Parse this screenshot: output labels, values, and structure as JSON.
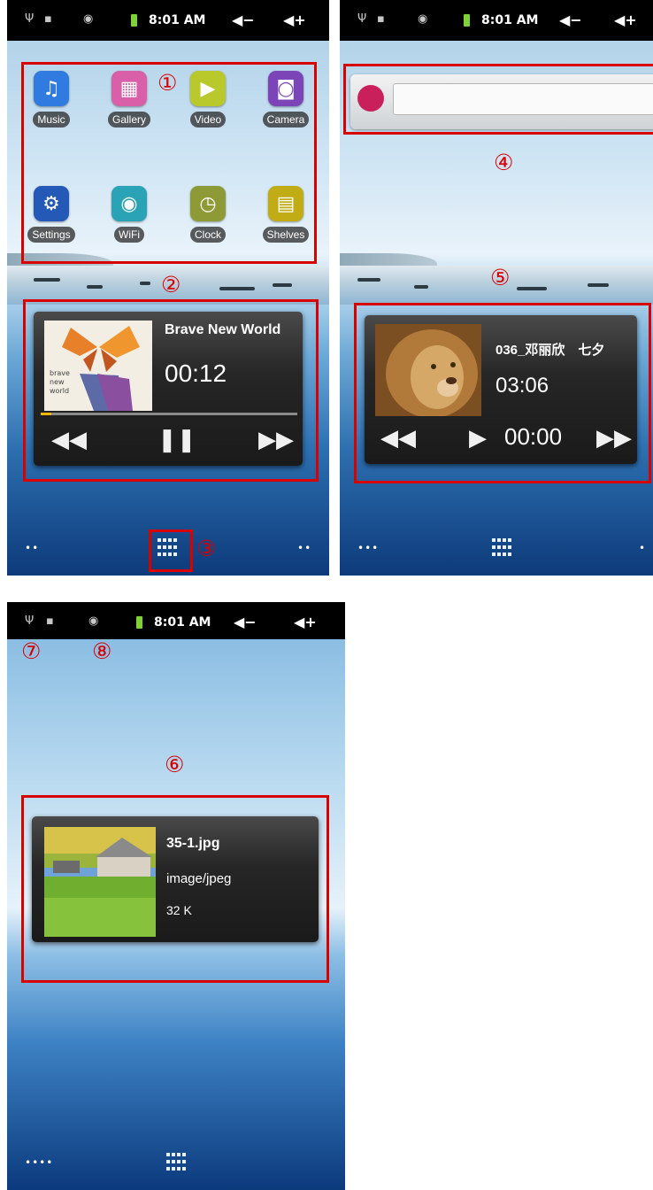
{
  "status_bar": {
    "time": "8:01 AM",
    "usb_icon": "usb-icon",
    "android_icon": "android-debug-icon",
    "wifi_icon": "wifi-icon",
    "battery_icon": "battery-icon",
    "vol_down": "◀−",
    "vol_up": "◀+"
  },
  "callouts": {
    "c1": "①",
    "c2": "②",
    "c3": "③",
    "c4": "④",
    "c5": "⑤",
    "c6": "⑥",
    "c7": "⑦",
    "c8": "⑧"
  },
  "apps": [
    {
      "label": "Music",
      "icon": "music-icon",
      "color": "#2f7be0"
    },
    {
      "label": "Gallery",
      "icon": "gallery-icon",
      "color": "#d85fa8"
    },
    {
      "label": "Video",
      "icon": "video-icon",
      "color": "#b9c82a"
    },
    {
      "label": "Camera",
      "icon": "camera-icon",
      "color": "#7b45b8"
    },
    {
      "label": "Settings",
      "icon": "settings-icon",
      "color": "#2459b8"
    },
    {
      "label": "WiFi",
      "icon": "wifi-icon",
      "color": "#2aa3b6"
    },
    {
      "label": "Clock",
      "icon": "clock-icon",
      "color": "#8e9a35"
    },
    {
      "label": "Shelves",
      "icon": "shelves-icon",
      "color": "#c1ac16"
    }
  ],
  "player1": {
    "title": "Brave New World",
    "time": "00:12",
    "progress": 0.04
  },
  "player2": {
    "title": "036_邓丽欣　七夕",
    "time": "03:06",
    "elapsed": "00:00"
  },
  "picture_widget": {
    "file_name": "35-1.jpg",
    "mime": "image/jpeg",
    "size": "32 K"
  },
  "bottom": {
    "dots_left_1": "••",
    "dots_right_1": "••",
    "dots_left_2": "•••",
    "dots_right_2": "•",
    "dots_left_3": "••••"
  }
}
